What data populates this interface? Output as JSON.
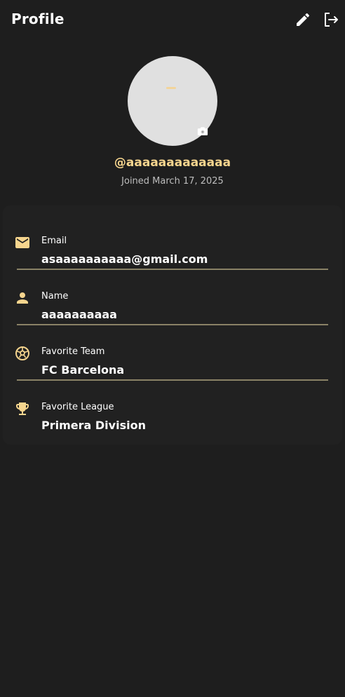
{
  "appbar": {
    "title": "Profile",
    "edit_icon": "pencil-icon",
    "logout_icon": "logout-icon"
  },
  "profile": {
    "username": "@aaaaaaaaaaaaa",
    "joined": "Joined March 17, 2025",
    "camera_icon": "camera-icon"
  },
  "info": [
    {
      "icon": "email-icon",
      "label": "Email",
      "value": "asaaaaaaaaaa@gmail.com"
    },
    {
      "icon": "person-icon",
      "label": "Name",
      "value": "aaaaaaaaaa"
    },
    {
      "icon": "soccer-ball-icon",
      "label": "Favorite Team",
      "value": "FC Barcelona"
    },
    {
      "icon": "trophy-icon",
      "label": "Favorite League",
      "value": "Primera Division"
    }
  ],
  "colors": {
    "background": "#1e1e1e",
    "card": "#212121",
    "accent": "#f6d58e",
    "divider": "#8a8266"
  }
}
